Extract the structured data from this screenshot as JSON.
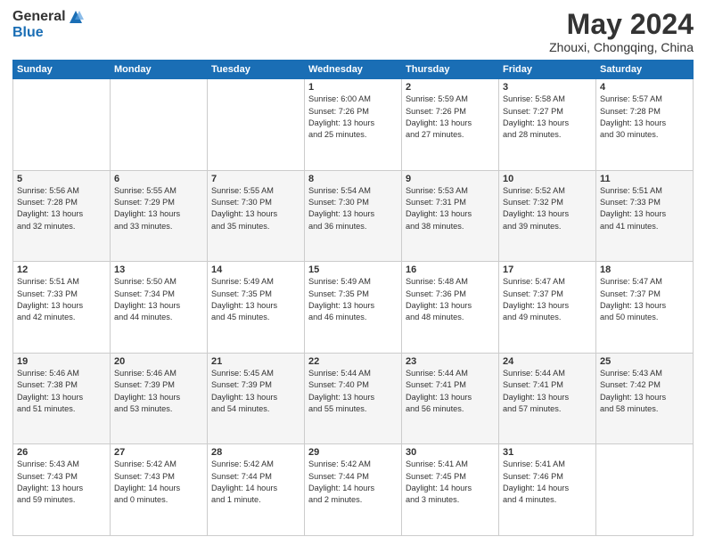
{
  "header": {
    "logo_general": "General",
    "logo_blue": "Blue",
    "month_title": "May 2024",
    "location": "Zhouxi, Chongqing, China"
  },
  "weekdays": [
    "Sunday",
    "Monday",
    "Tuesday",
    "Wednesday",
    "Thursday",
    "Friday",
    "Saturday"
  ],
  "weeks": [
    [
      {
        "day": "",
        "info": ""
      },
      {
        "day": "",
        "info": ""
      },
      {
        "day": "",
        "info": ""
      },
      {
        "day": "1",
        "info": "Sunrise: 6:00 AM\nSunset: 7:26 PM\nDaylight: 13 hours\nand 25 minutes."
      },
      {
        "day": "2",
        "info": "Sunrise: 5:59 AM\nSunset: 7:26 PM\nDaylight: 13 hours\nand 27 minutes."
      },
      {
        "day": "3",
        "info": "Sunrise: 5:58 AM\nSunset: 7:27 PM\nDaylight: 13 hours\nand 28 minutes."
      },
      {
        "day": "4",
        "info": "Sunrise: 5:57 AM\nSunset: 7:28 PM\nDaylight: 13 hours\nand 30 minutes."
      }
    ],
    [
      {
        "day": "5",
        "info": "Sunrise: 5:56 AM\nSunset: 7:28 PM\nDaylight: 13 hours\nand 32 minutes."
      },
      {
        "day": "6",
        "info": "Sunrise: 5:55 AM\nSunset: 7:29 PM\nDaylight: 13 hours\nand 33 minutes."
      },
      {
        "day": "7",
        "info": "Sunrise: 5:55 AM\nSunset: 7:30 PM\nDaylight: 13 hours\nand 35 minutes."
      },
      {
        "day": "8",
        "info": "Sunrise: 5:54 AM\nSunset: 7:30 PM\nDaylight: 13 hours\nand 36 minutes."
      },
      {
        "day": "9",
        "info": "Sunrise: 5:53 AM\nSunset: 7:31 PM\nDaylight: 13 hours\nand 38 minutes."
      },
      {
        "day": "10",
        "info": "Sunrise: 5:52 AM\nSunset: 7:32 PM\nDaylight: 13 hours\nand 39 minutes."
      },
      {
        "day": "11",
        "info": "Sunrise: 5:51 AM\nSunset: 7:33 PM\nDaylight: 13 hours\nand 41 minutes."
      }
    ],
    [
      {
        "day": "12",
        "info": "Sunrise: 5:51 AM\nSunset: 7:33 PM\nDaylight: 13 hours\nand 42 minutes."
      },
      {
        "day": "13",
        "info": "Sunrise: 5:50 AM\nSunset: 7:34 PM\nDaylight: 13 hours\nand 44 minutes."
      },
      {
        "day": "14",
        "info": "Sunrise: 5:49 AM\nSunset: 7:35 PM\nDaylight: 13 hours\nand 45 minutes."
      },
      {
        "day": "15",
        "info": "Sunrise: 5:49 AM\nSunset: 7:35 PM\nDaylight: 13 hours\nand 46 minutes."
      },
      {
        "day": "16",
        "info": "Sunrise: 5:48 AM\nSunset: 7:36 PM\nDaylight: 13 hours\nand 48 minutes."
      },
      {
        "day": "17",
        "info": "Sunrise: 5:47 AM\nSunset: 7:37 PM\nDaylight: 13 hours\nand 49 minutes."
      },
      {
        "day": "18",
        "info": "Sunrise: 5:47 AM\nSunset: 7:37 PM\nDaylight: 13 hours\nand 50 minutes."
      }
    ],
    [
      {
        "day": "19",
        "info": "Sunrise: 5:46 AM\nSunset: 7:38 PM\nDaylight: 13 hours\nand 51 minutes."
      },
      {
        "day": "20",
        "info": "Sunrise: 5:46 AM\nSunset: 7:39 PM\nDaylight: 13 hours\nand 53 minutes."
      },
      {
        "day": "21",
        "info": "Sunrise: 5:45 AM\nSunset: 7:39 PM\nDaylight: 13 hours\nand 54 minutes."
      },
      {
        "day": "22",
        "info": "Sunrise: 5:44 AM\nSunset: 7:40 PM\nDaylight: 13 hours\nand 55 minutes."
      },
      {
        "day": "23",
        "info": "Sunrise: 5:44 AM\nSunset: 7:41 PM\nDaylight: 13 hours\nand 56 minutes."
      },
      {
        "day": "24",
        "info": "Sunrise: 5:44 AM\nSunset: 7:41 PM\nDaylight: 13 hours\nand 57 minutes."
      },
      {
        "day": "25",
        "info": "Sunrise: 5:43 AM\nSunset: 7:42 PM\nDaylight: 13 hours\nand 58 minutes."
      }
    ],
    [
      {
        "day": "26",
        "info": "Sunrise: 5:43 AM\nSunset: 7:43 PM\nDaylight: 13 hours\nand 59 minutes."
      },
      {
        "day": "27",
        "info": "Sunrise: 5:42 AM\nSunset: 7:43 PM\nDaylight: 14 hours\nand 0 minutes."
      },
      {
        "day": "28",
        "info": "Sunrise: 5:42 AM\nSunset: 7:44 PM\nDaylight: 14 hours\nand 1 minute."
      },
      {
        "day": "29",
        "info": "Sunrise: 5:42 AM\nSunset: 7:44 PM\nDaylight: 14 hours\nand 2 minutes."
      },
      {
        "day": "30",
        "info": "Sunrise: 5:41 AM\nSunset: 7:45 PM\nDaylight: 14 hours\nand 3 minutes."
      },
      {
        "day": "31",
        "info": "Sunrise: 5:41 AM\nSunset: 7:46 PM\nDaylight: 14 hours\nand 4 minutes."
      },
      {
        "day": "",
        "info": ""
      }
    ]
  ]
}
